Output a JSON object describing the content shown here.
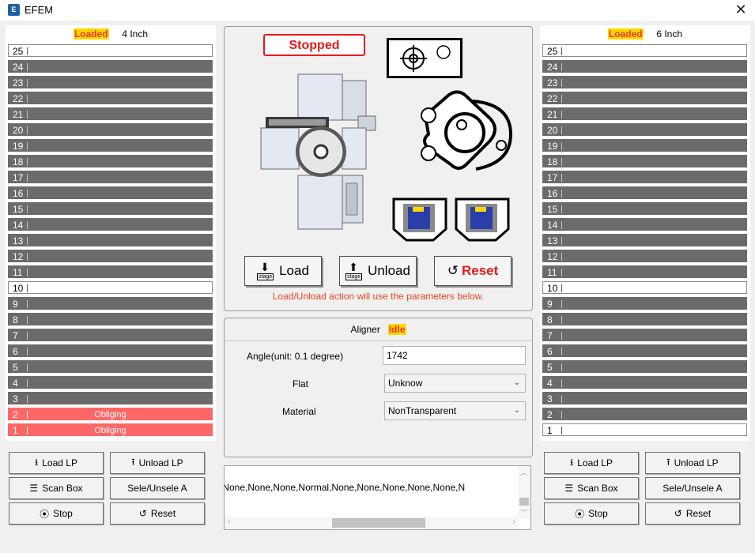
{
  "window": {
    "title": "EFEM",
    "icon_text": "E"
  },
  "left_port": {
    "badge": "Loaded",
    "size": "4 Inch",
    "slots": [
      {
        "num": "25",
        "state": "empty",
        "status": ""
      },
      {
        "num": "24",
        "state": "dark",
        "status": ""
      },
      {
        "num": "23",
        "state": "dark",
        "status": ""
      },
      {
        "num": "22",
        "state": "dark",
        "status": ""
      },
      {
        "num": "21",
        "state": "dark",
        "status": ""
      },
      {
        "num": "20",
        "state": "dark",
        "status": ""
      },
      {
        "num": "19",
        "state": "dark",
        "status": ""
      },
      {
        "num": "18",
        "state": "dark",
        "status": ""
      },
      {
        "num": "17",
        "state": "dark",
        "status": ""
      },
      {
        "num": "16",
        "state": "dark",
        "status": ""
      },
      {
        "num": "15",
        "state": "dark",
        "status": ""
      },
      {
        "num": "14",
        "state": "dark",
        "status": ""
      },
      {
        "num": "13",
        "state": "dark",
        "status": ""
      },
      {
        "num": "12",
        "state": "dark",
        "status": ""
      },
      {
        "num": "11",
        "state": "dark",
        "status": ""
      },
      {
        "num": "10",
        "state": "empty",
        "status": ""
      },
      {
        "num": "9",
        "state": "dark",
        "status": ""
      },
      {
        "num": "8",
        "state": "dark",
        "status": ""
      },
      {
        "num": "7",
        "state": "dark",
        "status": ""
      },
      {
        "num": "6",
        "state": "dark",
        "status": ""
      },
      {
        "num": "5",
        "state": "dark",
        "status": ""
      },
      {
        "num": "4",
        "state": "dark",
        "status": ""
      },
      {
        "num": "3",
        "state": "dark",
        "status": ""
      },
      {
        "num": "2",
        "state": "red",
        "status": "Obliging"
      },
      {
        "num": "1",
        "state": "red",
        "status": "Obliging"
      }
    ],
    "buttons": {
      "load_lp": "Load LP",
      "unload_lp": "Unload LP",
      "scan_box": "Scan Box",
      "sele": "Sele/Unsele A",
      "stop": "Stop",
      "reset": "Reset"
    }
  },
  "right_port": {
    "badge": "Loaded",
    "size": "6 Inch",
    "slots": [
      {
        "num": "25",
        "state": "empty",
        "status": ""
      },
      {
        "num": "24",
        "state": "dark",
        "status": ""
      },
      {
        "num": "23",
        "state": "dark",
        "status": ""
      },
      {
        "num": "22",
        "state": "dark",
        "status": ""
      },
      {
        "num": "21",
        "state": "dark",
        "status": ""
      },
      {
        "num": "20",
        "state": "dark",
        "status": ""
      },
      {
        "num": "19",
        "state": "dark",
        "status": ""
      },
      {
        "num": "18",
        "state": "dark",
        "status": ""
      },
      {
        "num": "17",
        "state": "dark",
        "status": ""
      },
      {
        "num": "16",
        "state": "dark",
        "status": ""
      },
      {
        "num": "15",
        "state": "dark",
        "status": ""
      },
      {
        "num": "14",
        "state": "dark",
        "status": ""
      },
      {
        "num": "13",
        "state": "dark",
        "status": ""
      },
      {
        "num": "12",
        "state": "dark",
        "status": ""
      },
      {
        "num": "11",
        "state": "dark",
        "status": ""
      },
      {
        "num": "10",
        "state": "empty",
        "status": ""
      },
      {
        "num": "9",
        "state": "dark",
        "status": ""
      },
      {
        "num": "8",
        "state": "dark",
        "status": ""
      },
      {
        "num": "7",
        "state": "dark",
        "status": ""
      },
      {
        "num": "6",
        "state": "dark",
        "status": ""
      },
      {
        "num": "5",
        "state": "dark",
        "status": ""
      },
      {
        "num": "4",
        "state": "dark",
        "status": ""
      },
      {
        "num": "3",
        "state": "dark",
        "status": ""
      },
      {
        "num": "2",
        "state": "dark",
        "status": ""
      },
      {
        "num": "1",
        "state": "empty",
        "status": ""
      }
    ],
    "buttons": {
      "load_lp": "Load LP",
      "unload_lp": "Unload LP",
      "scan_box": "Scan Box",
      "sele": "Sele/Unsele A",
      "stop": "Stop",
      "reset": "Reset"
    }
  },
  "center": {
    "status": "Stopped",
    "load_label": "Load",
    "unload_label": "Unload",
    "reset_label": "Reset",
    "stage_label": "stage",
    "note": "Load/Unload action will use the parameters below."
  },
  "aligner": {
    "title": "Aligner",
    "state": "Idle",
    "angle_label": "Angle(unit: 0.1 degree)",
    "angle_value": "1742",
    "flat_label": "Flat",
    "flat_value": "Unknow",
    "material_label": "Material",
    "material_value": "NonTransparent"
  },
  "log": {
    "text": ",None,None,None,Normal,None,None,None,None,None,N"
  },
  "colors": {
    "loaded_badge_bg": "#ffd700",
    "loaded_badge_fg": "#e63b2b",
    "stopped_red": "#e8191b",
    "slot_dark": "#6b6b6b",
    "slot_error": "#ff6666",
    "note_orange": "#e8481b"
  }
}
